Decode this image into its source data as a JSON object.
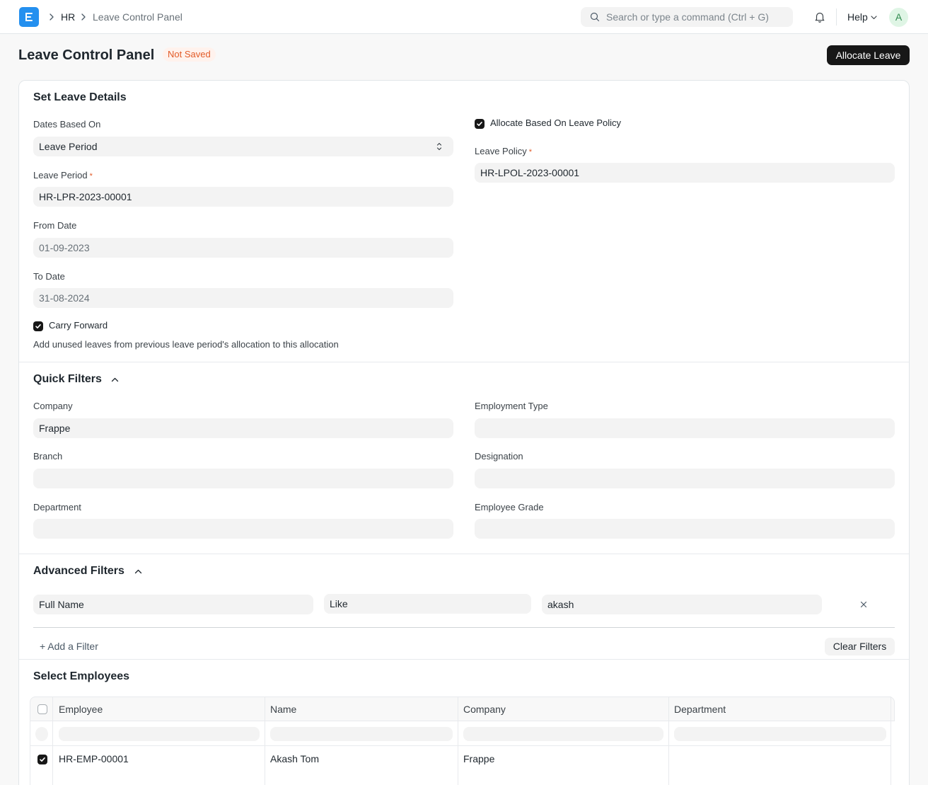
{
  "navbar": {
    "breadcrumb": [
      "HR",
      "Leave Control Panel"
    ],
    "search_placeholder": "Search or type a command (Ctrl + G)",
    "help_label": "Help",
    "avatar_initial": "A"
  },
  "page": {
    "title": "Leave Control Panel",
    "status_badge": "Not Saved",
    "primary_action": "Allocate Leave"
  },
  "leave_details": {
    "title": "Set Leave Details",
    "dates_based_on": {
      "label": "Dates Based On",
      "value": "Leave Period"
    },
    "leave_period": {
      "label": "Leave Period",
      "value": "HR-LPR-2023-00001"
    },
    "from_date": {
      "label": "From Date",
      "value": "01-09-2023"
    },
    "to_date": {
      "label": "To Date",
      "value": "31-08-2024"
    },
    "carry_forward": {
      "label": "Carry Forward",
      "checked": true,
      "description": "Add unused leaves from previous leave period's allocation to this allocation"
    },
    "allocate_by_policy": {
      "label": "Allocate Based On Leave Policy",
      "checked": true
    },
    "leave_policy": {
      "label": "Leave Policy",
      "value": "HR-LPOL-2023-00001"
    }
  },
  "quick_filters": {
    "title": "Quick Filters",
    "company": {
      "label": "Company",
      "value": "Frappe"
    },
    "branch": {
      "label": "Branch",
      "value": ""
    },
    "department": {
      "label": "Department",
      "value": ""
    },
    "employment_type": {
      "label": "Employment Type",
      "value": ""
    },
    "designation": {
      "label": "Designation",
      "value": ""
    },
    "employee_grade": {
      "label": "Employee Grade",
      "value": ""
    }
  },
  "advanced_filters": {
    "title": "Advanced Filters",
    "filter": {
      "field": "Full Name",
      "condition": "Like",
      "value": "akash"
    },
    "add_filter": "+ Add a Filter",
    "clear_filters": "Clear Filters"
  },
  "employees": {
    "title": "Select Employees",
    "columns": [
      "Employee",
      "Name",
      "Company",
      "Department"
    ],
    "rows": [
      {
        "employee": "HR-EMP-00001",
        "name": "Akash Tom",
        "company": "Frappe",
        "department": "",
        "checked": true
      }
    ]
  }
}
